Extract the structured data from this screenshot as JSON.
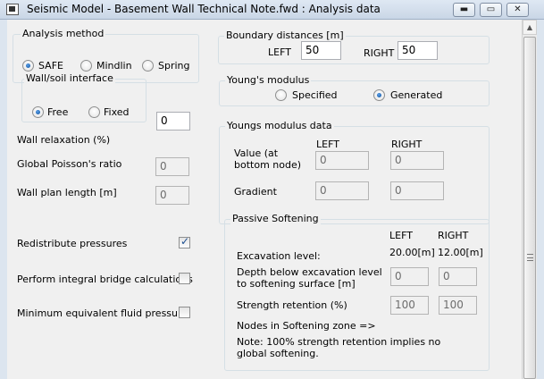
{
  "window": {
    "title": "Seismic Model - Basement Wall Technical Note.fwd : Analysis data",
    "minimize": "▬",
    "maximize": "▭",
    "close": "✕"
  },
  "analysis_method": {
    "legend": "Analysis method",
    "options": [
      "SAFE",
      "Mindlin",
      "Spring"
    ],
    "selected": "SAFE"
  },
  "wall_soil_interface": {
    "legend": "Wall/soil interface",
    "options": [
      "Free",
      "Fixed"
    ],
    "selected": "Free"
  },
  "wall_relaxation": {
    "label": "Wall relaxation (%)",
    "value": "0"
  },
  "global_poisson": {
    "label": "Global Poisson's ratio",
    "value": "0"
  },
  "wall_plan_length": {
    "label": "Wall plan length [m]",
    "value": "0"
  },
  "checkboxes": {
    "redistribute": {
      "label": "Redistribute pressures",
      "checked": true
    },
    "integral_bridge": {
      "label": "Perform integral bridge calculations",
      "checked": false
    },
    "min_fluid_pressure": {
      "label": "Minimum equivalent fluid pressure",
      "checked": false
    }
  },
  "boundary": {
    "legend": "Boundary distances [m]",
    "left_label": "LEFT",
    "left_value": "50",
    "right_label": "RIGHT",
    "right_value": "50"
  },
  "youngs_modulus": {
    "legend": "Young's modulus",
    "options": [
      "Specified",
      "Generated"
    ],
    "selected": "Generated"
  },
  "youngs_data": {
    "legend": "Youngs modulus data",
    "col_left": "LEFT",
    "col_right": "RIGHT",
    "value_label": "Value (at\nbottom node)",
    "value_left": "0",
    "value_right": "0",
    "gradient_label": "Gradient",
    "gradient_left": "0",
    "gradient_right": "0"
  },
  "passive_softening": {
    "legend": "Passive Softening",
    "col_left": "LEFT",
    "col_right": "RIGHT",
    "excavation_label": "Excavation level:",
    "excavation_left": "20.00[m]",
    "excavation_right": "12.00[m]",
    "depth_label": "Depth below excavation level\nto softening surface [m]",
    "depth_left": "0",
    "depth_right": "0",
    "strength_label": "Strength retention (%)",
    "strength_left": "100",
    "strength_right": "100",
    "nodes_label": "Nodes in Softening zone =>",
    "note": "Note: 100% strength retention implies no\nglobal softening."
  }
}
